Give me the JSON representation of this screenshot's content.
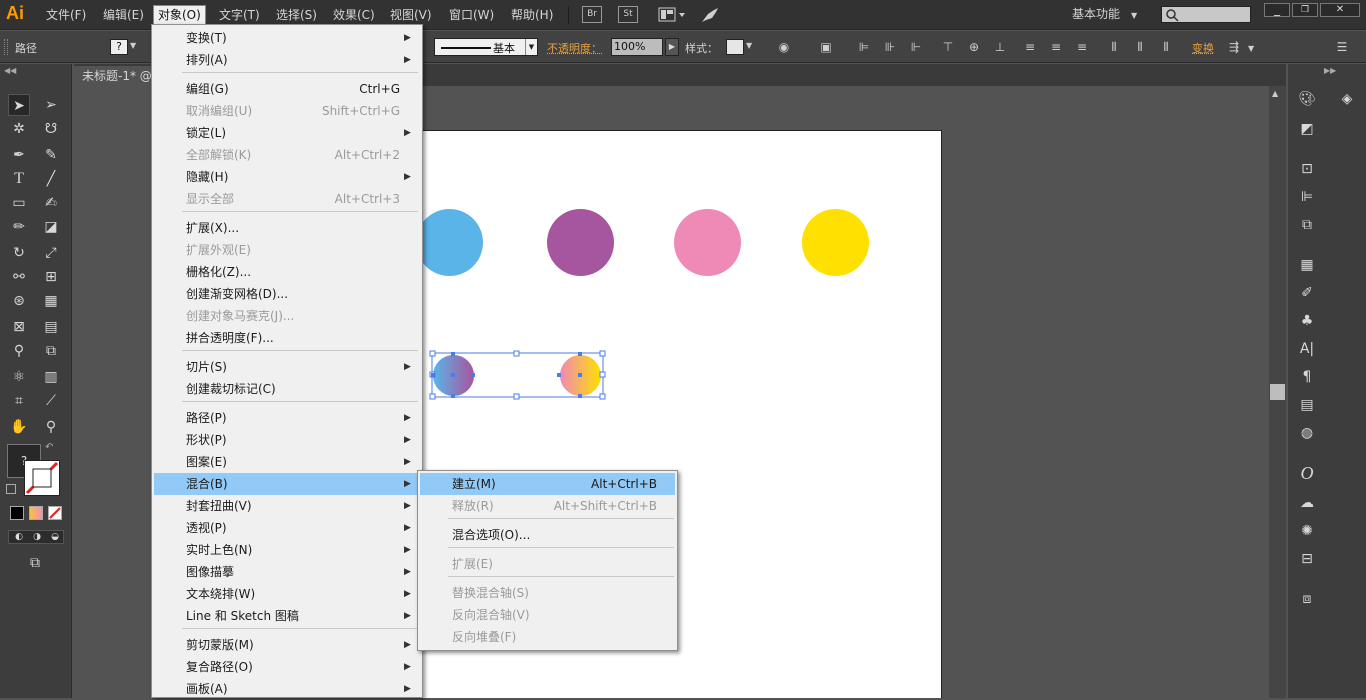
{
  "app": {
    "logo": "Ai"
  },
  "menubar": {
    "items": [
      "文件(F)",
      "编辑(E)",
      "对象(O)",
      "文字(T)",
      "选择(S)",
      "效果(C)",
      "视图(V)",
      "窗口(W)",
      "帮助(H)"
    ],
    "bridge_label": "Br",
    "stock_label": "St",
    "workspace": "基本功能",
    "search_placeholder": ""
  },
  "controlbar": {
    "selection_label": "路径",
    "stroke_style": "基本",
    "opacity_label": "不透明度：",
    "opacity_value": "100%",
    "style_label": "样式：",
    "transform_label": "变换"
  },
  "document": {
    "tab_title": "未标题-1* @"
  },
  "colors": {
    "circle_blue": "#5bb4e8",
    "circle_purple": "#a6559f",
    "circle_pink": "#ef89b5",
    "circle_yellow": "#ffe000",
    "selection": "#4a7de8",
    "menu_highlight": "#91c9f7"
  },
  "object_menu": {
    "items": [
      {
        "label": "变换(T)",
        "shortcut": "",
        "submenu": true,
        "disabled": false
      },
      {
        "label": "排列(A)",
        "shortcut": "",
        "submenu": true,
        "disabled": false
      },
      {
        "label": "编组(G)",
        "shortcut": "Ctrl+G",
        "submenu": false,
        "disabled": false
      },
      {
        "label": "取消编组(U)",
        "shortcut": "Shift+Ctrl+G",
        "submenu": false,
        "disabled": true
      },
      {
        "label": "锁定(L)",
        "shortcut": "",
        "submenu": true,
        "disabled": false
      },
      {
        "label": "全部解锁(K)",
        "shortcut": "Alt+Ctrl+2",
        "submenu": false,
        "disabled": true
      },
      {
        "label": "隐藏(H)",
        "shortcut": "",
        "submenu": true,
        "disabled": false
      },
      {
        "label": "显示全部",
        "shortcut": "Alt+Ctrl+3",
        "submenu": false,
        "disabled": true
      },
      {
        "label": "扩展(X)...",
        "shortcut": "",
        "submenu": false,
        "disabled": false
      },
      {
        "label": "扩展外观(E)",
        "shortcut": "",
        "submenu": false,
        "disabled": true
      },
      {
        "label": "栅格化(Z)...",
        "shortcut": "",
        "submenu": false,
        "disabled": false
      },
      {
        "label": "创建渐变网格(D)...",
        "shortcut": "",
        "submenu": false,
        "disabled": false
      },
      {
        "label": "创建对象马赛克(J)...",
        "shortcut": "",
        "submenu": false,
        "disabled": true
      },
      {
        "label": "拼合透明度(F)...",
        "shortcut": "",
        "submenu": false,
        "disabled": false
      },
      {
        "label": "切片(S)",
        "shortcut": "",
        "submenu": true,
        "disabled": false
      },
      {
        "label": "创建裁切标记(C)",
        "shortcut": "",
        "submenu": false,
        "disabled": false
      },
      {
        "label": "路径(P)",
        "shortcut": "",
        "submenu": true,
        "disabled": false
      },
      {
        "label": "形状(P)",
        "shortcut": "",
        "submenu": true,
        "disabled": false
      },
      {
        "label": "图案(E)",
        "shortcut": "",
        "submenu": true,
        "disabled": false
      },
      {
        "label": "混合(B)",
        "shortcut": "",
        "submenu": true,
        "disabled": false
      },
      {
        "label": "封套扭曲(V)",
        "shortcut": "",
        "submenu": true,
        "disabled": false
      },
      {
        "label": "透视(P)",
        "shortcut": "",
        "submenu": true,
        "disabled": false
      },
      {
        "label": "实时上色(N)",
        "shortcut": "",
        "submenu": true,
        "disabled": false
      },
      {
        "label": "图像描摹",
        "shortcut": "",
        "submenu": true,
        "disabled": false
      },
      {
        "label": "文本绕排(W)",
        "shortcut": "",
        "submenu": true,
        "disabled": false
      },
      {
        "label": "Line 和 Sketch 图稿",
        "shortcut": "",
        "submenu": true,
        "disabled": false
      },
      {
        "label": "剪切蒙版(M)",
        "shortcut": "",
        "submenu": true,
        "disabled": false
      },
      {
        "label": "复合路径(O)",
        "shortcut": "",
        "submenu": true,
        "disabled": false
      },
      {
        "label": "画板(A)",
        "shortcut": "",
        "submenu": true,
        "disabled": false
      }
    ]
  },
  "blend_submenu": {
    "items": [
      {
        "label": "建立(M)",
        "shortcut": "Alt+Ctrl+B",
        "disabled": false
      },
      {
        "label": "释放(R)",
        "shortcut": "Alt+Shift+Ctrl+B",
        "disabled": true
      },
      {
        "label": "混合选项(O)...",
        "shortcut": "",
        "disabled": false
      },
      {
        "label": "扩展(E)",
        "shortcut": "",
        "disabled": true
      },
      {
        "label": "替换混合轴(S)",
        "shortcut": "",
        "disabled": true
      },
      {
        "label": "反向混合轴(V)",
        "shortcut": "",
        "disabled": true
      },
      {
        "label": "反向堆叠(F)",
        "shortcut": "",
        "disabled": true
      }
    ]
  }
}
